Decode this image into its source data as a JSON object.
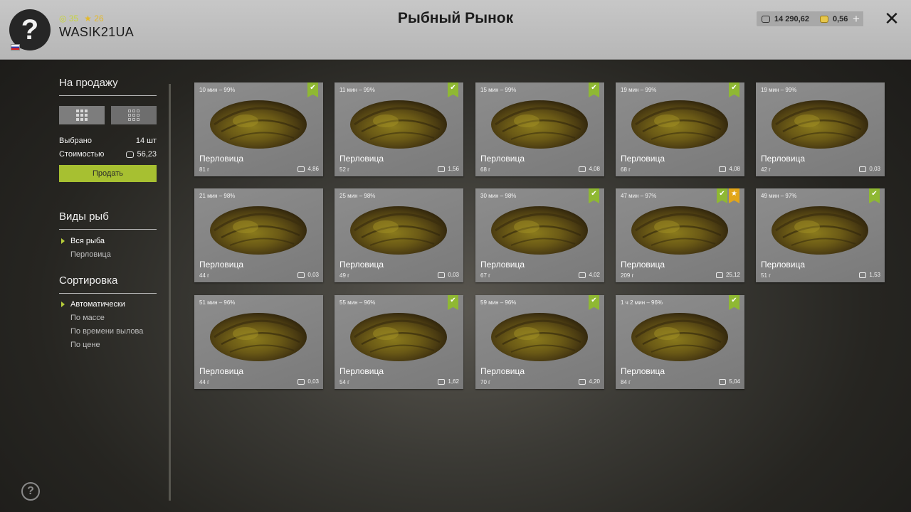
{
  "header": {
    "title": "Рыбный Рынок",
    "user": {
      "name": "WASIK21UA",
      "xp_level": "35",
      "star_level": "26"
    },
    "currency": {
      "silver": "14 290,62",
      "gold": "0,56",
      "add_label": "+"
    }
  },
  "sidebar": {
    "sale_title": "На продажу",
    "selected_label": "Выбрано",
    "selected_value": "14 шт",
    "cost_label": "Стоимостью",
    "cost_value": "56,23",
    "sell_button": "Продать",
    "fish_types_title": "Виды рыб",
    "fish_types": [
      {
        "label": "Вся рыба",
        "selected": true
      },
      {
        "label": "Перловица",
        "selected": false
      }
    ],
    "sort_title": "Сортировка",
    "sort_options": [
      {
        "label": "Автоматически",
        "selected": true
      },
      {
        "label": "По массе",
        "selected": false
      },
      {
        "label": "По времени вылова",
        "selected": false
      },
      {
        "label": "По цене",
        "selected": false
      }
    ]
  },
  "fish": [
    {
      "meta": "10 мин – 99%",
      "name": "Перловица",
      "weight": "81 г",
      "price": "4,86",
      "check": true,
      "star": false
    },
    {
      "meta": "11 мин – 99%",
      "name": "Перловица",
      "weight": "52 г",
      "price": "1,56",
      "check": true,
      "star": false
    },
    {
      "meta": "15 мин – 99%",
      "name": "Перловица",
      "weight": "68 г",
      "price": "4,08",
      "check": true,
      "star": false
    },
    {
      "meta": "19 мин – 99%",
      "name": "Перловица",
      "weight": "68 г",
      "price": "4,08",
      "check": true,
      "star": false
    },
    {
      "meta": "19 мин – 99%",
      "name": "Перловица",
      "weight": "42 г",
      "price": "0,03",
      "check": false,
      "star": false
    },
    {
      "meta": "21 мин – 98%",
      "name": "Перловица",
      "weight": "44 г",
      "price": "0,03",
      "check": false,
      "star": false
    },
    {
      "meta": "25 мин – 98%",
      "name": "Перловица",
      "weight": "49 г",
      "price": "0,03",
      "check": false,
      "star": false
    },
    {
      "meta": "30 мин – 98%",
      "name": "Перловица",
      "weight": "67 г",
      "price": "4,02",
      "check": true,
      "star": false
    },
    {
      "meta": "47 мин – 97%",
      "name": "Перловица",
      "weight": "209 г",
      "price": "25,12",
      "check": true,
      "star": true
    },
    {
      "meta": "49 мин – 97%",
      "name": "Перловица",
      "weight": "51 г",
      "price": "1,53",
      "check": true,
      "star": false
    },
    {
      "meta": "51 мин – 96%",
      "name": "Перловица",
      "weight": "44 г",
      "price": "0,03",
      "check": false,
      "star": false
    },
    {
      "meta": "55 мин – 96%",
      "name": "Перловица",
      "weight": "54 г",
      "price": "1,62",
      "check": true,
      "star": false
    },
    {
      "meta": "59 мин – 96%",
      "name": "Перловица",
      "weight": "70 г",
      "price": "4,20",
      "check": true,
      "star": false
    },
    {
      "meta": "1 ч 2 мин – 96%",
      "name": "Перловица",
      "weight": "84 г",
      "price": "5,04",
      "check": true,
      "star": false
    }
  ]
}
